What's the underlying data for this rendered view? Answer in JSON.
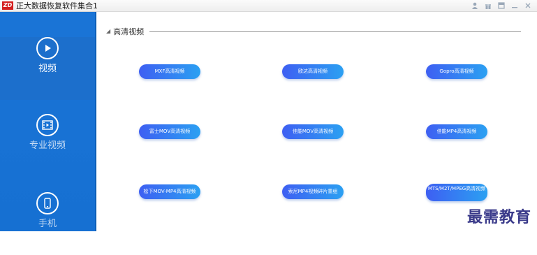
{
  "window": {
    "logo_text": "ZD",
    "title": "正大数据恢复软件集合1",
    "controls": [
      "user-icon",
      "gift-icon",
      "skin-icon",
      "minimize-icon",
      "close-icon"
    ]
  },
  "sidebar": {
    "items": [
      {
        "label": "视频",
        "icon": "play-icon",
        "active": true
      },
      {
        "label": "专业视频",
        "icon": "film-icon",
        "active": false
      },
      {
        "label": "手机",
        "icon": "phone-icon",
        "active": false
      }
    ]
  },
  "main": {
    "section_title": "高清视频",
    "buttons": [
      {
        "label": "MXF高清视频"
      },
      {
        "label": "欧达高清视频"
      },
      {
        "label": "Gopro高清视频"
      },
      {
        "label": "富士MOV高清视频"
      },
      {
        "label": "佳能MOV高清视频"
      },
      {
        "label": "佳能MP4高清视频"
      },
      {
        "label": "松下MOV-MP4高清视频"
      },
      {
        "label": "索尼MP4视频碎片重组"
      },
      {
        "label": "MTS/M2T/MPEG高清视频"
      }
    ]
  },
  "watermark": "最需教育"
}
